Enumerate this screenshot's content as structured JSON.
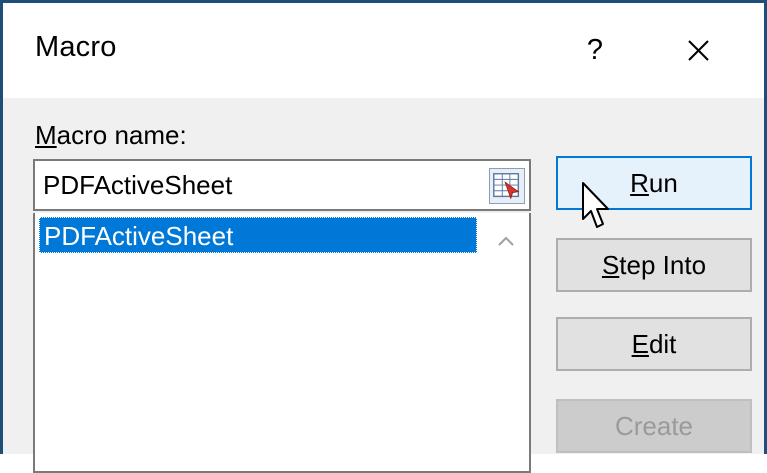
{
  "window": {
    "title": "Macro",
    "help_label": "?"
  },
  "macro_name": {
    "label_mnemonic": "M",
    "label_rest": "acro name:",
    "value": "PDFActiveSheet"
  },
  "macro_list": {
    "items": [
      {
        "label": "PDFActiveSheet",
        "selected": true
      }
    ]
  },
  "buttons": {
    "run": {
      "mnemonic": "R",
      "rest": "un"
    },
    "step_into": {
      "mnemonic": "S",
      "rest": "tep Into"
    },
    "edit": {
      "mnemonic": "E",
      "rest": "dit"
    },
    "create": {
      "label": "Create",
      "enabled": false
    }
  },
  "colors": {
    "selection": "#0078d7",
    "frame": "#1f4e79",
    "default_button_border": "#0078d7"
  },
  "icons": {
    "close": "close-icon",
    "range_picker": "range-picker-icon",
    "scroll_up": "chevron-up-icon",
    "cursor": "mouse-pointer-icon"
  }
}
